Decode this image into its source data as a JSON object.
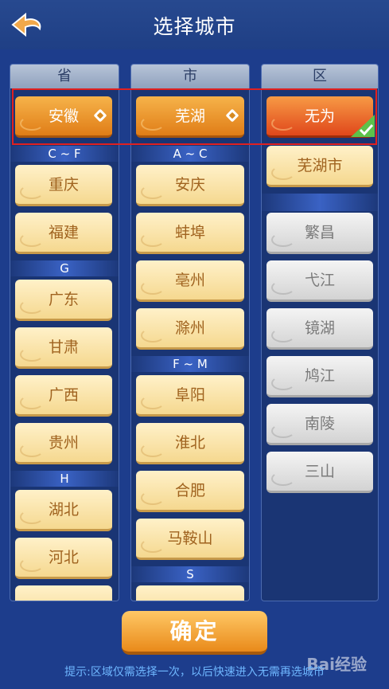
{
  "header": {
    "title": "选择城市",
    "back_icon": "spade-back-icon"
  },
  "columns": {
    "province": {
      "header": "省",
      "selected": "安徽",
      "groups": [
        {
          "letter": "C ~ F",
          "items": [
            "重庆",
            "福建"
          ]
        },
        {
          "letter": "G",
          "items": [
            "广东",
            "甘肃",
            "广西",
            "贵州"
          ]
        },
        {
          "letter": "H",
          "items": [
            "湖北",
            "河北",
            ""
          ]
        }
      ]
    },
    "city": {
      "header": "市",
      "selected": "芜湖",
      "groups": [
        {
          "letter": "A ~ C",
          "items": [
            "安庆",
            "蚌埠",
            "亳州",
            "滁州"
          ]
        },
        {
          "letter": "F ~ M",
          "items": [
            "阜阳",
            "淮北",
            "合肥",
            "马鞍山"
          ]
        },
        {
          "letter": "S",
          "items": [
            ""
          ]
        }
      ]
    },
    "district": {
      "header": "区",
      "selected": "无为",
      "items": [
        "芜湖市"
      ],
      "gray_items": [
        "繁昌",
        "弋江",
        "镜湖",
        "鸠江",
        "南陵",
        "三山"
      ]
    }
  },
  "confirm_label": "确定",
  "hint": "提示:区域仅需选择一次，以后快速进入无需再选城市",
  "watermark": "Bai经验",
  "colors": {
    "background": "#1d3d8c",
    "accent": "#e98a1a",
    "highlight_border": "#e02020"
  }
}
